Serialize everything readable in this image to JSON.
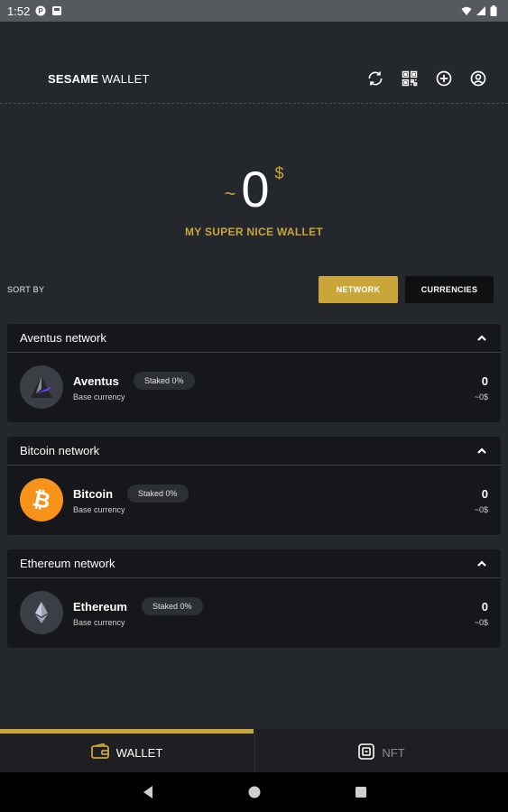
{
  "status_bar": {
    "time": "1:52"
  },
  "header": {
    "brand_bold": "SESAME",
    "brand_light": " WALLET",
    "icons": [
      "refresh-icon",
      "qr-scan-icon",
      "add-circle-icon",
      "account-icon"
    ]
  },
  "balance": {
    "tilde": "~",
    "amount": "0",
    "currency_symbol": "$",
    "wallet_name": "MY SUPER NICE WALLET"
  },
  "sort": {
    "label": "SORT BY",
    "network_label": "NETWORK",
    "currencies_label": "CURRENCIES",
    "selected": "NETWORK"
  },
  "networks": [
    {
      "title": "Aventus network",
      "coin": "Aventus",
      "staked": "Staked 0%",
      "sub": "Base currency",
      "amount": "0",
      "fiat": "~0$"
    },
    {
      "title": "Bitcoin network",
      "coin": "Bitcoin",
      "staked": "Staked 0%",
      "sub": "Base currency",
      "amount": "0",
      "fiat": "~0$"
    },
    {
      "title": "Ethereum network",
      "coin": "Ethereum",
      "staked": "Staked 0%",
      "sub": "Base currency",
      "amount": "0",
      "fiat": "~0$"
    }
  ],
  "tabs": {
    "wallet": "WALLET",
    "nft": "NFT",
    "active": "WALLET"
  },
  "colors": {
    "accent": "#c9a53a",
    "background": "#24272b",
    "card": "#15171a",
    "bitcoin": "#f7931a"
  }
}
